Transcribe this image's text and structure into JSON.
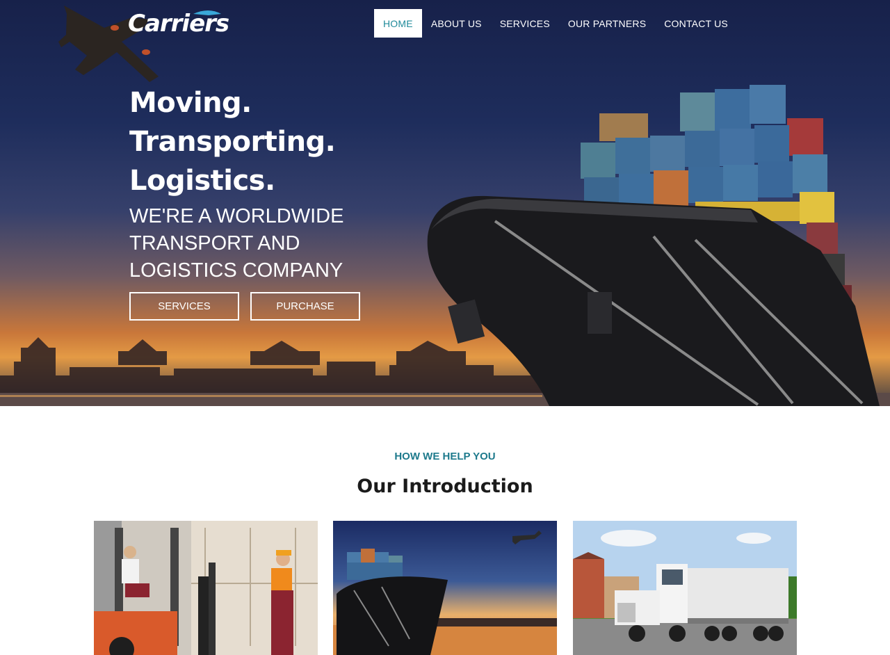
{
  "brand": {
    "logo_text": "Carriers"
  },
  "nav": {
    "items": [
      {
        "label": "HOME",
        "active": true
      },
      {
        "label": "ABOUT US",
        "active": false
      },
      {
        "label": "SERVICES",
        "active": false
      },
      {
        "label": "OUR PARTNERS",
        "active": false
      },
      {
        "label": "CONTACT US",
        "active": false
      }
    ]
  },
  "hero": {
    "headline": [
      "Moving.",
      "Transporting.",
      "Logistics."
    ],
    "subheadline": "WE'RE A WORLDWIDE TRANSPORT AND LOGISTICS COMPANY",
    "buttons": {
      "services": "SERVICES",
      "purchase": "PURCHASE"
    }
  },
  "intro": {
    "eyebrow": "HOW WE HELP YOU",
    "title": "Our Introduction"
  },
  "colors": {
    "accent": "#1e7a8c",
    "hero_sky_top": "#17214a",
    "sunset": "#e49a45"
  }
}
